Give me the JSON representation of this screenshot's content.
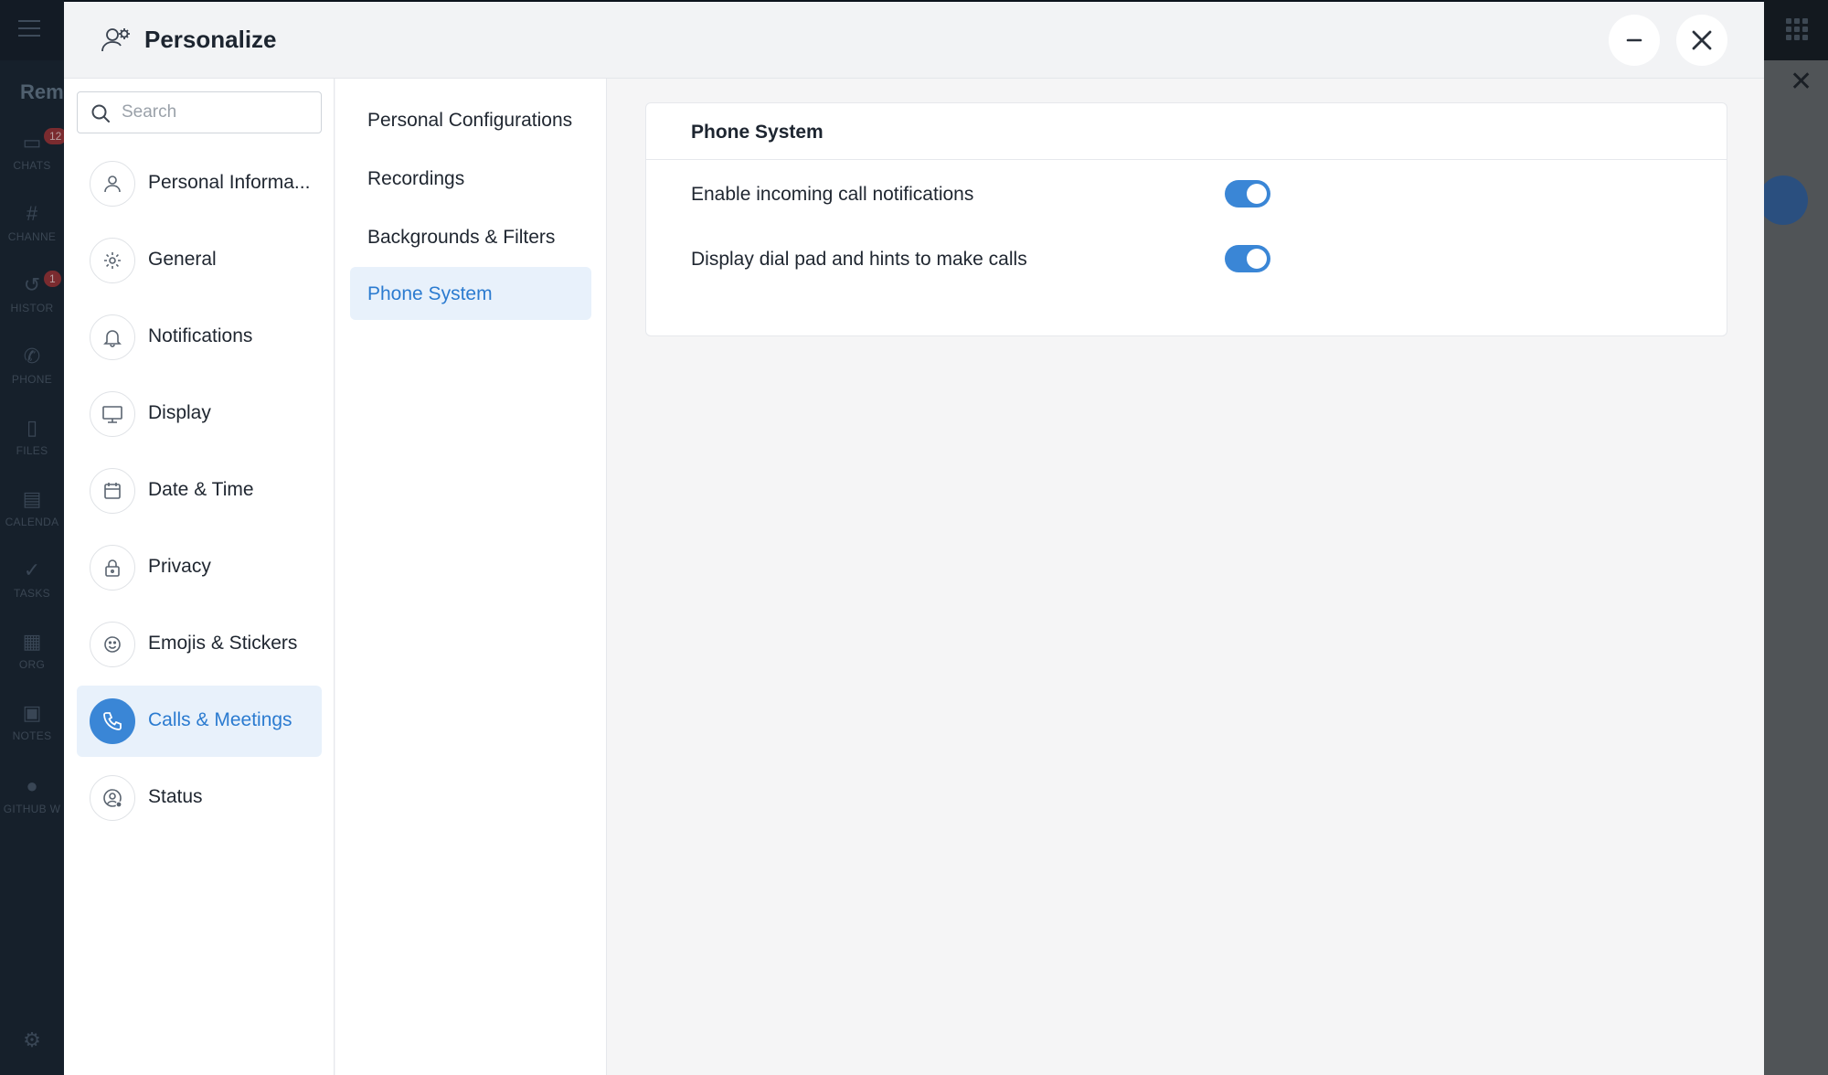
{
  "background_app": {
    "title_fragment": "Rem",
    "rail": [
      {
        "label": "CHATS",
        "icon": "chat-icon",
        "badge": "12"
      },
      {
        "label": "CHANNE",
        "icon": "hash-icon"
      },
      {
        "label": "HISTOR",
        "icon": "history-icon",
        "badge": "1"
      },
      {
        "label": "PHONE",
        "icon": "phone-icon"
      },
      {
        "label": "FILES",
        "icon": "file-icon"
      },
      {
        "label": "CALENDA",
        "icon": "calendar-icon"
      },
      {
        "label": "TASKS",
        "icon": "check-icon"
      },
      {
        "label": "ORG",
        "icon": "org-icon"
      },
      {
        "label": "NOTES",
        "icon": "notes-icon"
      },
      {
        "label": "GITHUB W",
        "icon": "github-icon"
      }
    ]
  },
  "modal": {
    "title": "Personalize",
    "header_icon": "users-gear-icon",
    "minimize_icon": "minus-icon",
    "close_icon": "close-icon"
  },
  "search": {
    "placeholder": "Search"
  },
  "categories": [
    {
      "label": "Personal Informa...",
      "icon": "user-icon"
    },
    {
      "label": "General",
      "icon": "gear-icon"
    },
    {
      "label": "Notifications",
      "icon": "bell-icon"
    },
    {
      "label": "Display",
      "icon": "monitor-icon"
    },
    {
      "label": "Date & Time",
      "icon": "calendar-icon"
    },
    {
      "label": "Privacy",
      "icon": "lock-icon"
    },
    {
      "label": "Emojis & Stickers",
      "icon": "smiley-icon"
    },
    {
      "label": "Calls & Meetings",
      "icon": "phone-icon",
      "active": true
    },
    {
      "label": "Status",
      "icon": "user-status-icon"
    }
  ],
  "subcategories": [
    {
      "label": "Personal Configurations"
    },
    {
      "label": "Recordings"
    },
    {
      "label": "Backgrounds & Filters"
    },
    {
      "label": "Phone System",
      "active": true
    }
  ],
  "phone_system": {
    "title": "Phone System",
    "settings": [
      {
        "label": "Enable incoming call notifications",
        "enabled": true
      },
      {
        "label": "Display dial pad and hints to make calls",
        "enabled": true
      }
    ]
  },
  "colors": {
    "accent": "#3a86d6",
    "active_bg": "#e8f1fb",
    "active_text": "#2b7bd0"
  }
}
